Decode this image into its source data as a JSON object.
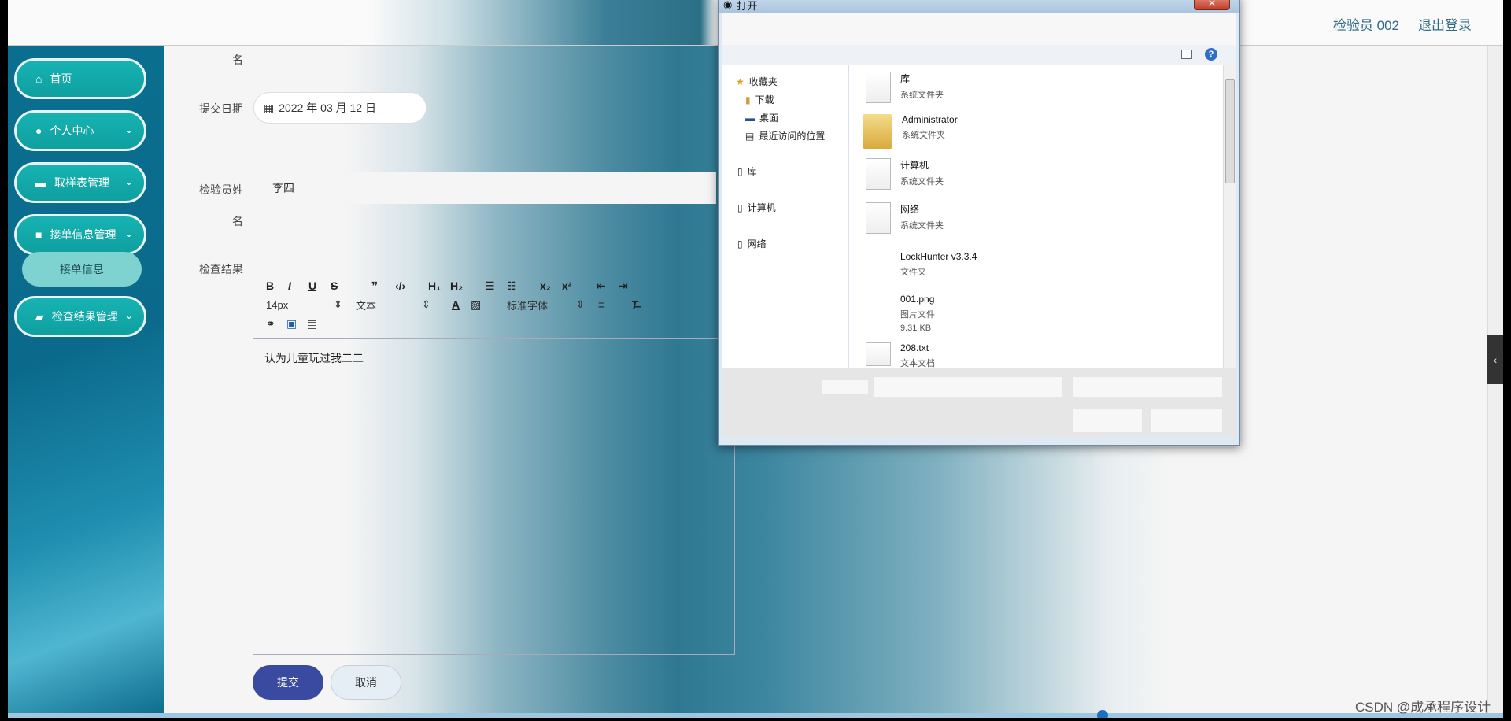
{
  "header": {
    "user_label": "检验员 002",
    "logout_label": "退出登录"
  },
  "sidebar": {
    "items": [
      {
        "label": "首页"
      },
      {
        "label": "个人中心"
      },
      {
        "label": "取样表管理"
      },
      {
        "label": "接单信息管理"
      },
      {
        "label": "检查结果管理"
      }
    ],
    "sub_item": "接单信息"
  },
  "form": {
    "name_tail_1": "名",
    "date_label": "提交日期",
    "date_value": "2022 年 03 月 12 日",
    "inspector_label": "检验员姓",
    "inspector_value": "李四",
    "name_tail_2": "名",
    "result_label": "检查结果",
    "editor_text": "认为儿童玩过我二二",
    "submit_label": "提交",
    "cancel_label": "取消"
  },
  "editor_toolbar": {
    "font_size": "14px",
    "text_style": "文本",
    "font_family": "标准字体"
  },
  "dialog": {
    "title": "打开",
    "nav": {
      "favorites": "收藏夹",
      "downloads": "下载",
      "desktop": "桌面",
      "recent": "最近访问的位置",
      "library": "库",
      "computer": "计算机",
      "network": "网络"
    },
    "files": [
      {
        "name": "库",
        "type": "系统文件夹",
        "size": ""
      },
      {
        "name": "Administrator",
        "type": "系统文件夹",
        "size": ""
      },
      {
        "name": "计算机",
        "type": "系统文件夹",
        "size": ""
      },
      {
        "name": "网络",
        "type": "系统文件夹",
        "size": ""
      },
      {
        "name": "LockHunter v3.3.4",
        "type": "文件夹",
        "size": ""
      },
      {
        "name": "001.png",
        "type": "图片文件",
        "size": "9.31 KB"
      },
      {
        "name": "208.txt",
        "type": "文本文档",
        "size": ""
      }
    ]
  },
  "watermark": "CSDN @成承程序设计"
}
